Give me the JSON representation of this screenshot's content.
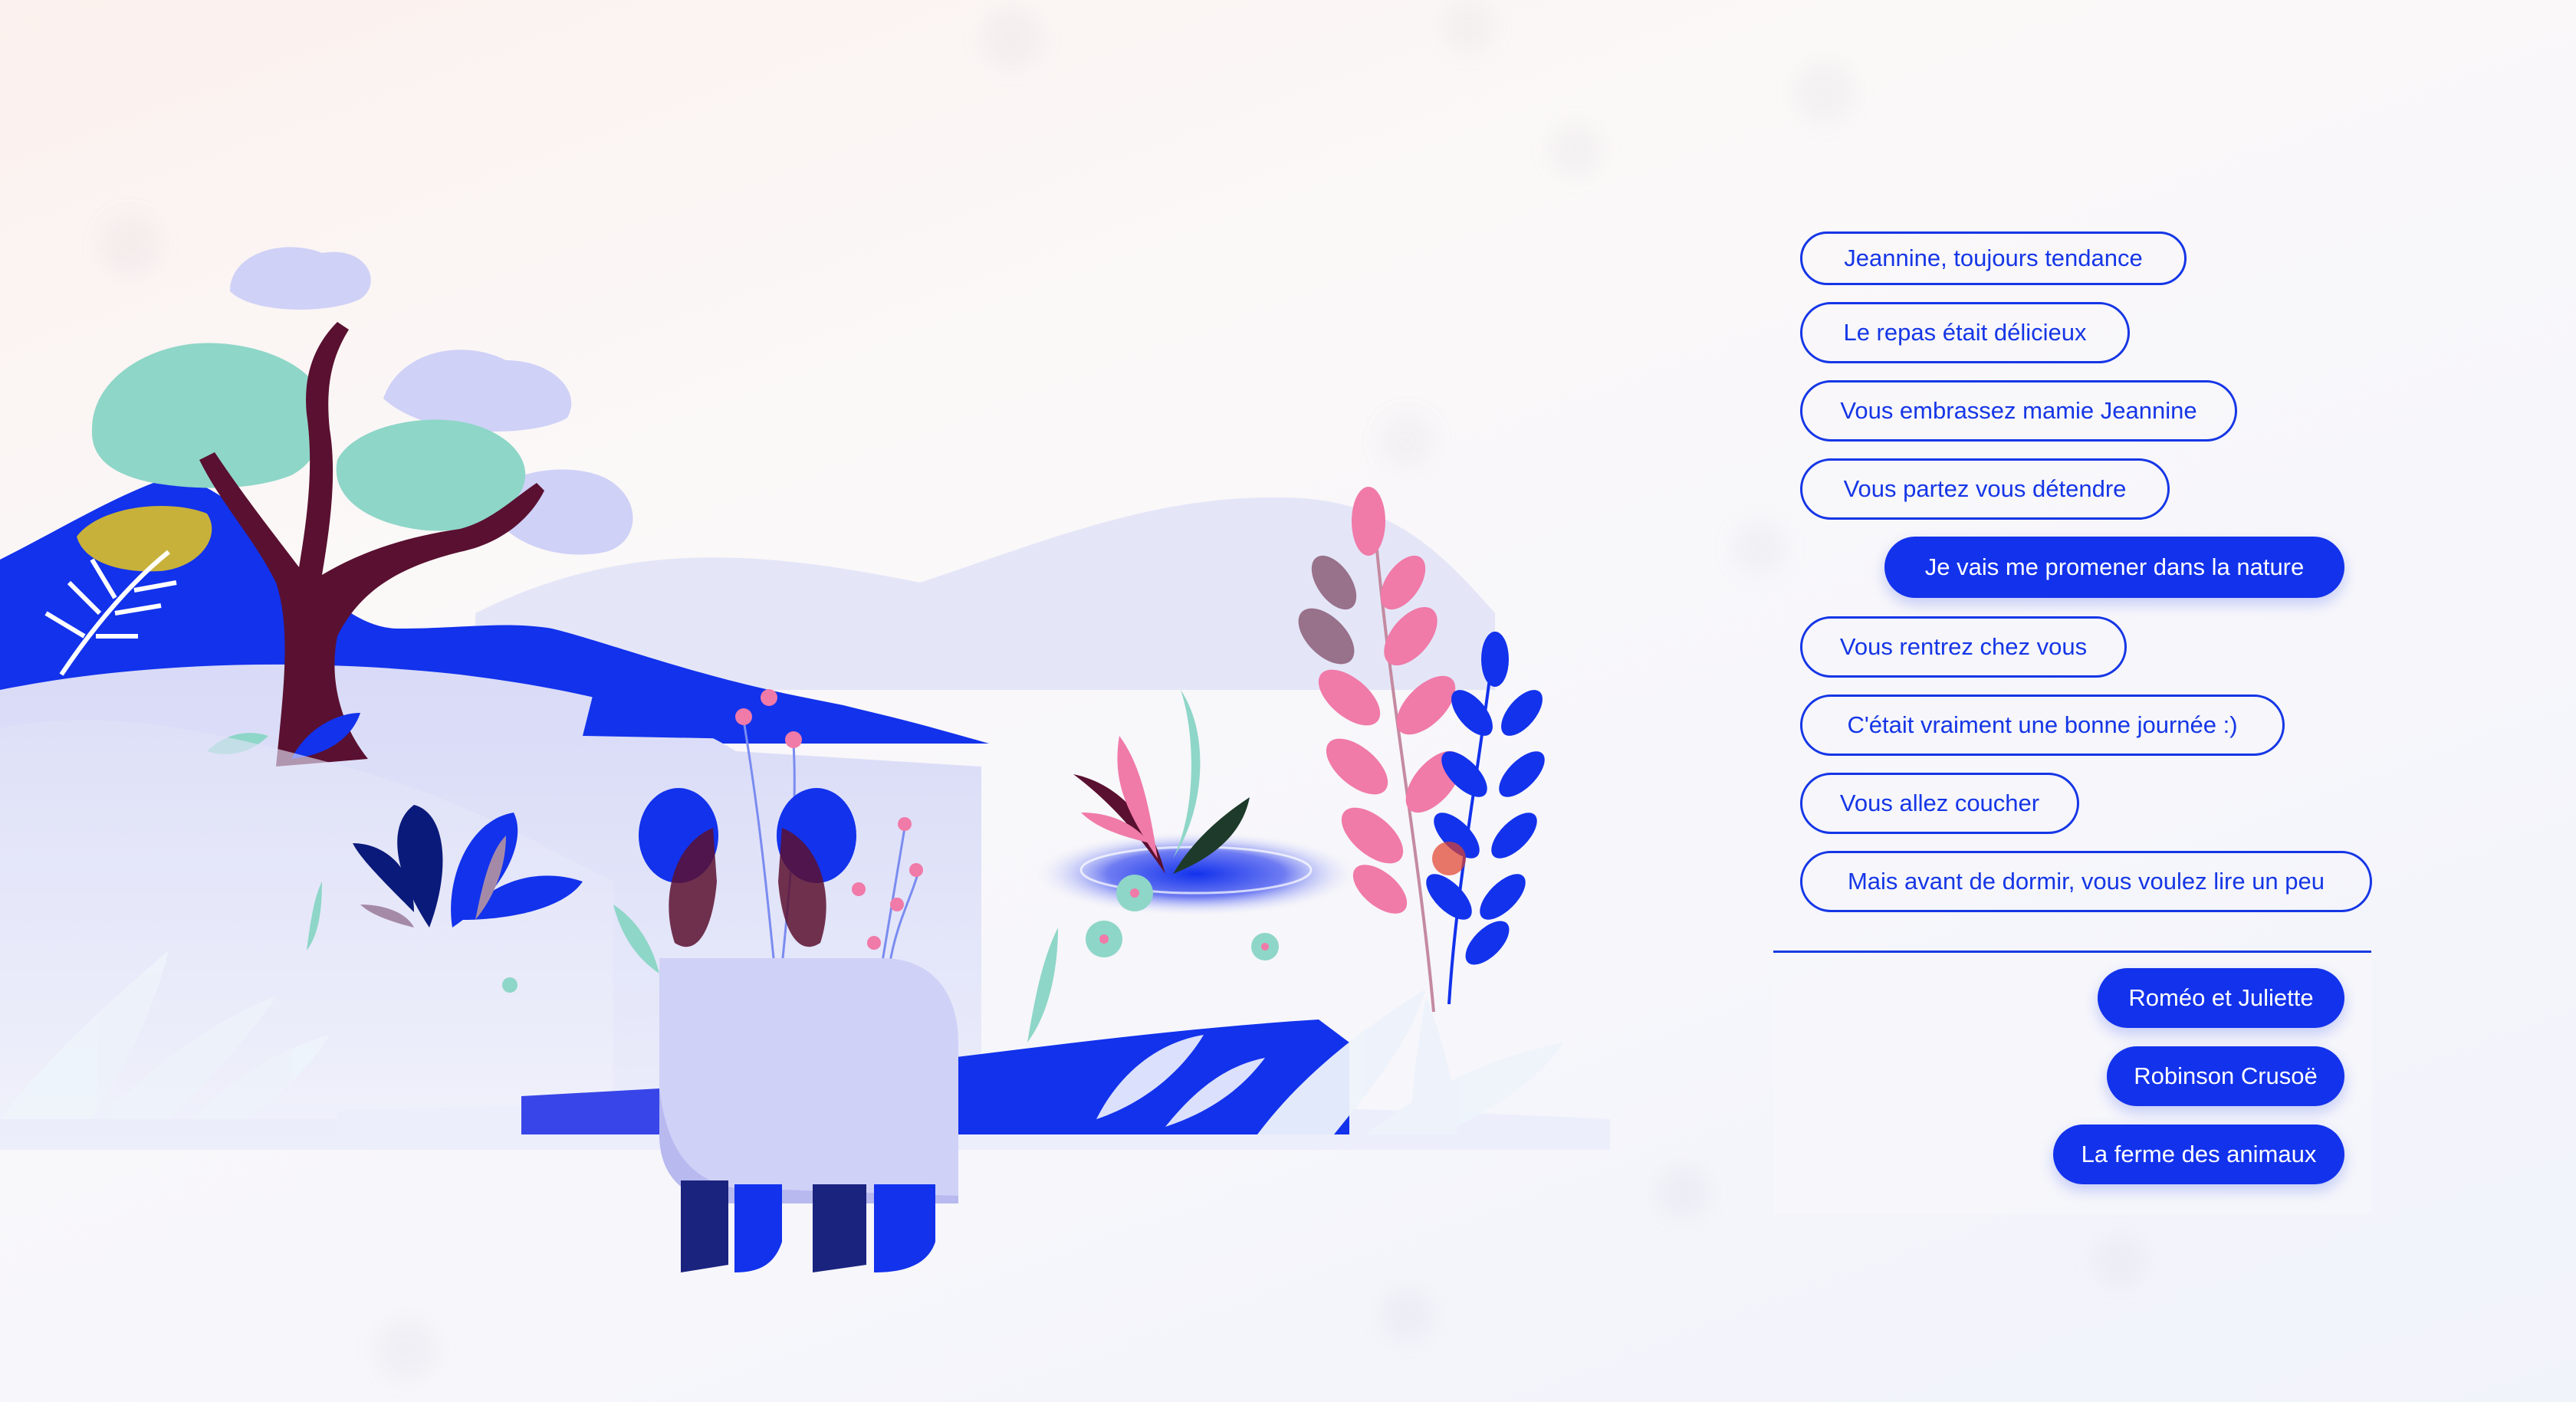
{
  "conversation": {
    "messages": [
      {
        "text": "Jeannine, toujours tendance",
        "role": "narration"
      },
      {
        "text": "Le repas était délicieux",
        "role": "narration"
      },
      {
        "text": "Vous embrassez mamie Jeannine",
        "role": "narration"
      },
      {
        "text": "Vous partez vous détendre",
        "role": "narration"
      },
      {
        "text": "Je vais me promener dans la nature",
        "role": "user"
      },
      {
        "text": "Vous rentrez chez vous",
        "role": "narration"
      },
      {
        "text": "C'était vraiment une bonne journée :)",
        "role": "narration"
      },
      {
        "text": "Vous allez coucher",
        "role": "narration"
      },
      {
        "text": "Mais avant de dormir, vous voulez lire un peu",
        "role": "narration"
      }
    ]
  },
  "choices": [
    {
      "label": "Roméo et Juliette"
    },
    {
      "label": "Robinson Crusoë"
    },
    {
      "label": "La ferme des animaux"
    }
  ],
  "colors": {
    "accent_blue": "#1232ec",
    "text_blue": "#1536e6",
    "deep_blue": "#0e2cff",
    "navy": "#1a237e",
    "lavender": "#cfd1f7",
    "mint": "#8ed6c8",
    "pink": "#f07aa8",
    "maroon": "#5a1030",
    "mustard": "#c7b13a"
  },
  "icons": {
    "scene": "nature-landscape-illustration"
  }
}
